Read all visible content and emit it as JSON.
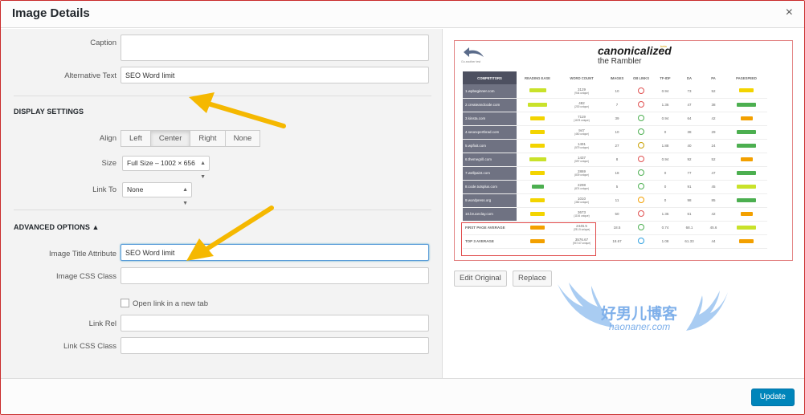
{
  "dialog": {
    "title": "Image Details",
    "close_label": "×"
  },
  "form": {
    "caption_label": "Caption",
    "caption_value": "",
    "alt_label": "Alternative Text",
    "alt_value": "SEO Word limit",
    "display_settings": "DISPLAY SETTINGS",
    "align_label": "Align",
    "align_options": [
      "Left",
      "Center",
      "Right",
      "None"
    ],
    "align_selected": "Center",
    "size_label": "Size",
    "size_value": "Full Size – 1002 × 656",
    "link_to_label": "Link To",
    "link_to_value": "None",
    "advanced_options": "ADVANCED OPTIONS ▲",
    "title_attr_label": "Image Title Attribute",
    "title_attr_value": "SEO Word limit",
    "css_class_label": "Image CSS Class",
    "css_class_value": "",
    "new_tab_label": "Open link in a new tab",
    "link_rel_label": "Link Rel",
    "link_rel_value": "",
    "link_css_label": "Link CSS Class",
    "link_css_value": ""
  },
  "preview": {
    "back_text": "Go another test",
    "brand": "canonicalized",
    "brand_sup": "beta",
    "subtitle": "the Rambler",
    "headers": [
      "COMPETITORS",
      "READING EASE",
      "WORD COUNT",
      "IMAGES",
      "OB LINKS",
      "TF-IDF",
      "DA",
      "PA",
      "PAGESPEED"
    ],
    "rows": [
      {
        "name": "1.wpbeginner.com",
        "wc": "3129",
        "wcu": "(944 unique)",
        "img": "10",
        "ob": "",
        "tf": "0.94",
        "da": "73",
        "pa": "52",
        "re": 0.7,
        "rec": "#c9e22a",
        "ps": 0.6,
        "psc": "#f3d400",
        "obc": "#e05050"
      },
      {
        "name": "2.createandcode.com",
        "wc": "482",
        "wcu": "(230 unique)",
        "img": "7",
        "ob": "",
        "tf": "1.36",
        "da": "47",
        "pa": "38",
        "re": 0.8,
        "rec": "#c9e22a",
        "ps": 0.8,
        "psc": "#4caf50",
        "obc": "#e05050"
      },
      {
        "name": "3.kinsta.com",
        "wc": "7119",
        "wcu": "(1678 unique)",
        "img": "39",
        "ob": "",
        "tf": "0.94",
        "da": "64",
        "pa": "42",
        "re": 0.6,
        "rec": "#f3d400",
        "ps": 0.5,
        "psc": "#f3a000",
        "obc": "#4caf50"
      },
      {
        "name": "4.seoexpertbrad.com",
        "wc": "947",
        "wcu": "(460 unique)",
        "img": "10",
        "ob": "",
        "tf": "0",
        "da": "38",
        "pa": "29",
        "re": 0.6,
        "rec": "#f3d400",
        "ps": 0.8,
        "psc": "#4caf50",
        "obc": "#4caf50"
      },
      {
        "name": "5.wpfixit.com",
        "wc": "1491",
        "wcu": "(579 unique)",
        "img": "27",
        "ob": "",
        "tf": "1.88",
        "da": "40",
        "pa": "24",
        "re": 0.6,
        "rec": "#f3d400",
        "ps": 0.8,
        "psc": "#4caf50",
        "obc": "#c9a000"
      },
      {
        "name": "6.themegrill.com",
        "wc": "1437",
        "wcu": "(597 unique)",
        "img": "8",
        "ob": "",
        "tf": "0.94",
        "da": "92",
        "pa": "52",
        "re": 0.7,
        "rec": "#c9e22a",
        "ps": 0.5,
        "psc": "#f3a000",
        "obc": "#e05050"
      },
      {
        "name": "7.wellpaint.com",
        "wc": "2869",
        "wcu": "(839 unique)",
        "img": "18",
        "ob": "",
        "tf": "0",
        "da": "77",
        "pa": "47",
        "re": 0.6,
        "rec": "#f3d400",
        "ps": 0.8,
        "psc": "#4caf50",
        "obc": "#4caf50"
      },
      {
        "name": "8.code.tutsplus.com",
        "wc": "2298",
        "wcu": "(874 unique)",
        "img": "5",
        "ob": "",
        "tf": "0",
        "da": "91",
        "pa": "45",
        "re": 0.5,
        "rec": "#4caf50",
        "ps": 0.8,
        "psc": "#c9e22a",
        "obc": "#4caf50"
      },
      {
        "name": "9.wordpress.org",
        "wc": "1010",
        "wcu": "(382 unique)",
        "img": "11",
        "ob": "",
        "tf": "0",
        "da": "98",
        "pa": "85",
        "re": 0.6,
        "rec": "#f3d400",
        "ps": 0.8,
        "psc": "#4caf50",
        "obc": "#f3a000"
      },
      {
        "name": "10.bruceclay.com",
        "wc": "3673",
        "wcu": "(1154 unique)",
        "img": "50",
        "ob": "",
        "tf": "1.36",
        "da": "61",
        "pa": "42",
        "re": 0.6,
        "rec": "#f3d400",
        "ps": 0.5,
        "psc": "#f3a000",
        "obc": "#e05050"
      }
    ],
    "avg_rows": [
      {
        "name": "FIRST PAGE AVERAGE",
        "wc": "2445.5",
        "wcu": "(781.5 unique)",
        "img": "18.5",
        "tf": "0.74",
        "da": "68.1",
        "pa": "45.6",
        "re": 0.6,
        "rec": "#f3a000",
        "ps": 0.8,
        "psc": "#c9e22a",
        "obc": "#4caf50"
      },
      {
        "name": "TOP 3 AVERAGE",
        "wc": "3576.67",
        "wcu": "(937.67 unique)",
        "img": "18.67",
        "tf": "1.08",
        "da": "61.33",
        "pa": "44",
        "re": 0.6,
        "rec": "#f3a000",
        "ps": 0.6,
        "psc": "#f3a000",
        "obc": "#30a0e0"
      }
    ]
  },
  "actions": {
    "edit_original": "Edit Original",
    "replace": "Replace",
    "update": "Update"
  },
  "watermark": {
    "cn": "好男儿博客",
    "en": "haonaner.com"
  },
  "colors": {
    "accent": "#0085ba",
    "arrow": "#f5b800",
    "frame": "#c92a2a"
  }
}
